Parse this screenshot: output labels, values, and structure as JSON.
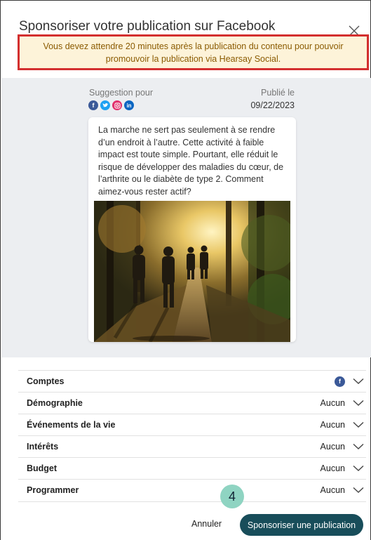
{
  "dialog": {
    "title": "Sponsoriser votre publication sur Facebook",
    "alert": "Vous devez attendre 20 minutes après la publication du contenu pour pouvoir promouvoir la publication via Hearsay Social."
  },
  "preview": {
    "suggestion_label": "Suggestion pour",
    "published_label": "Publié le",
    "published_date": "09/22/2023",
    "social_icons": [
      "facebook-icon",
      "twitter-icon",
      "instagram-icon",
      "linkedin-icon"
    ],
    "post_text": "La marche ne sert pas seulement à se rendre d’un endroit à l’autre. Cette activité à faible impact est toute simple. Pourtant, elle réduit le risque de développer des maladies du cœur, de l’arthrite ou le diabète de type 2. Comment aimez-vous rester actif?"
  },
  "rows": [
    {
      "label": "Comptes",
      "value": "",
      "icon": "facebook-icon"
    },
    {
      "label": "Démographie",
      "value": "Aucun"
    },
    {
      "label": "Événements de la vie",
      "value": "Aucun"
    },
    {
      "label": "Intérêts",
      "value": "Aucun"
    },
    {
      "label": "Budget",
      "value": "Aucun"
    },
    {
      "label": "Programmer",
      "value": "Aucun"
    }
  ],
  "footer": {
    "step_badge": "4",
    "cancel_label": "Annuler",
    "sponsor_label": "Sponsoriser une publication"
  },
  "colors": {
    "alert_border": "#d32f2f",
    "alert_bg": "#fdf3d9",
    "primary_button": "#184d5a",
    "badge": "#8fd4c2",
    "facebook": "#3b5998",
    "twitter": "#1da1f2",
    "instagram": "#e1306c",
    "linkedin": "#0a66c2"
  }
}
